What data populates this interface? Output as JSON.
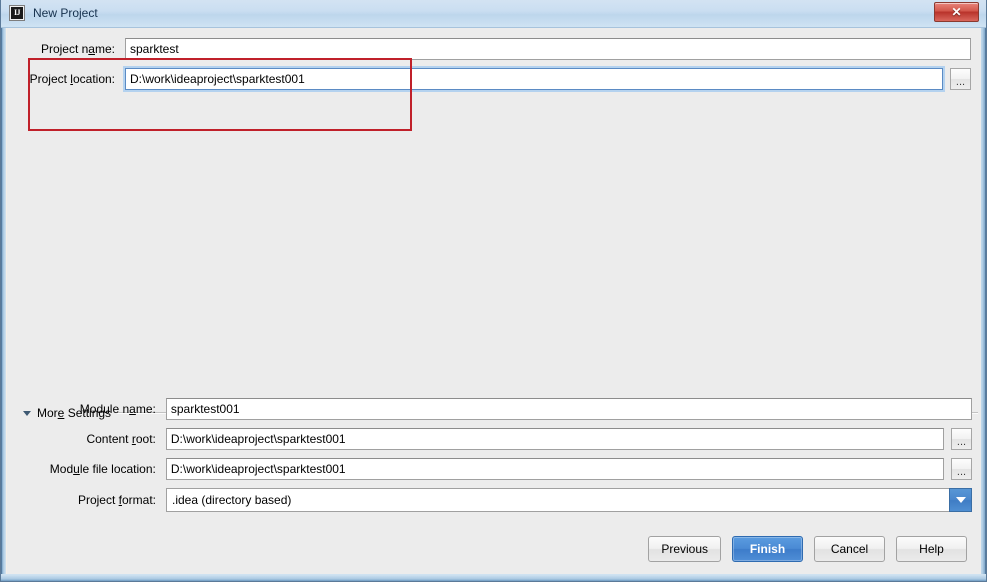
{
  "window": {
    "title": "New Project",
    "app_icon": "intellij-idea-icon",
    "icon_text": "IJ",
    "close_label": "✕"
  },
  "project_form": {
    "name_label_pre": "Project n",
    "name_label_mnemonic": "a",
    "name_label_post": "me:",
    "name_label_full": "Project name:",
    "name_value": "sparktest",
    "location_label_pre": "Project ",
    "location_label_mnemonic": "l",
    "location_label_post": "ocation:",
    "location_label_full": "Project location:",
    "location_value": "D:\\work\\ideaproject\\sparktest001",
    "browse_label": "..."
  },
  "more_settings": {
    "label_pre": "Mor",
    "label_mnemonic": "e",
    "label_post": " Settings",
    "label_full": "More Settings",
    "expanded": true,
    "toggle_icon": "chevron-down-icon"
  },
  "module_form": {
    "module_name_label_pre": "Module n",
    "module_name_label_mnemonic": "a",
    "module_name_label_post": "me:",
    "module_name_label_full": "Module name:",
    "module_name_value": "sparktest001",
    "content_root_label_pre": "Content ",
    "content_root_label_mnemonic": "r",
    "content_root_label_post": "oot:",
    "content_root_label_full": "Content root:",
    "content_root_value": "D:\\work\\ideaproject\\sparktest001",
    "module_file_label_pre": "Mod",
    "module_file_label_mnemonic": "u",
    "module_file_label_post": "le file location:",
    "module_file_label_full": "Module file location:",
    "module_file_value": "D:\\work\\ideaproject\\sparktest001",
    "project_format_label_pre": "Project ",
    "project_format_label_mnemonic": "f",
    "project_format_label_post": "ormat:",
    "project_format_label_full": "Project format:",
    "project_format_value": ".idea (directory based)",
    "browse_label": "..."
  },
  "buttons": {
    "previous": "Previous",
    "finish": "Finish",
    "cancel": "Cancel",
    "help": "Help"
  },
  "colors": {
    "accent_blue": "#4a87cc",
    "annotation_red": "#c0202a",
    "dialog_bg": "#ececec",
    "focus_border": "#5b8bc4"
  }
}
